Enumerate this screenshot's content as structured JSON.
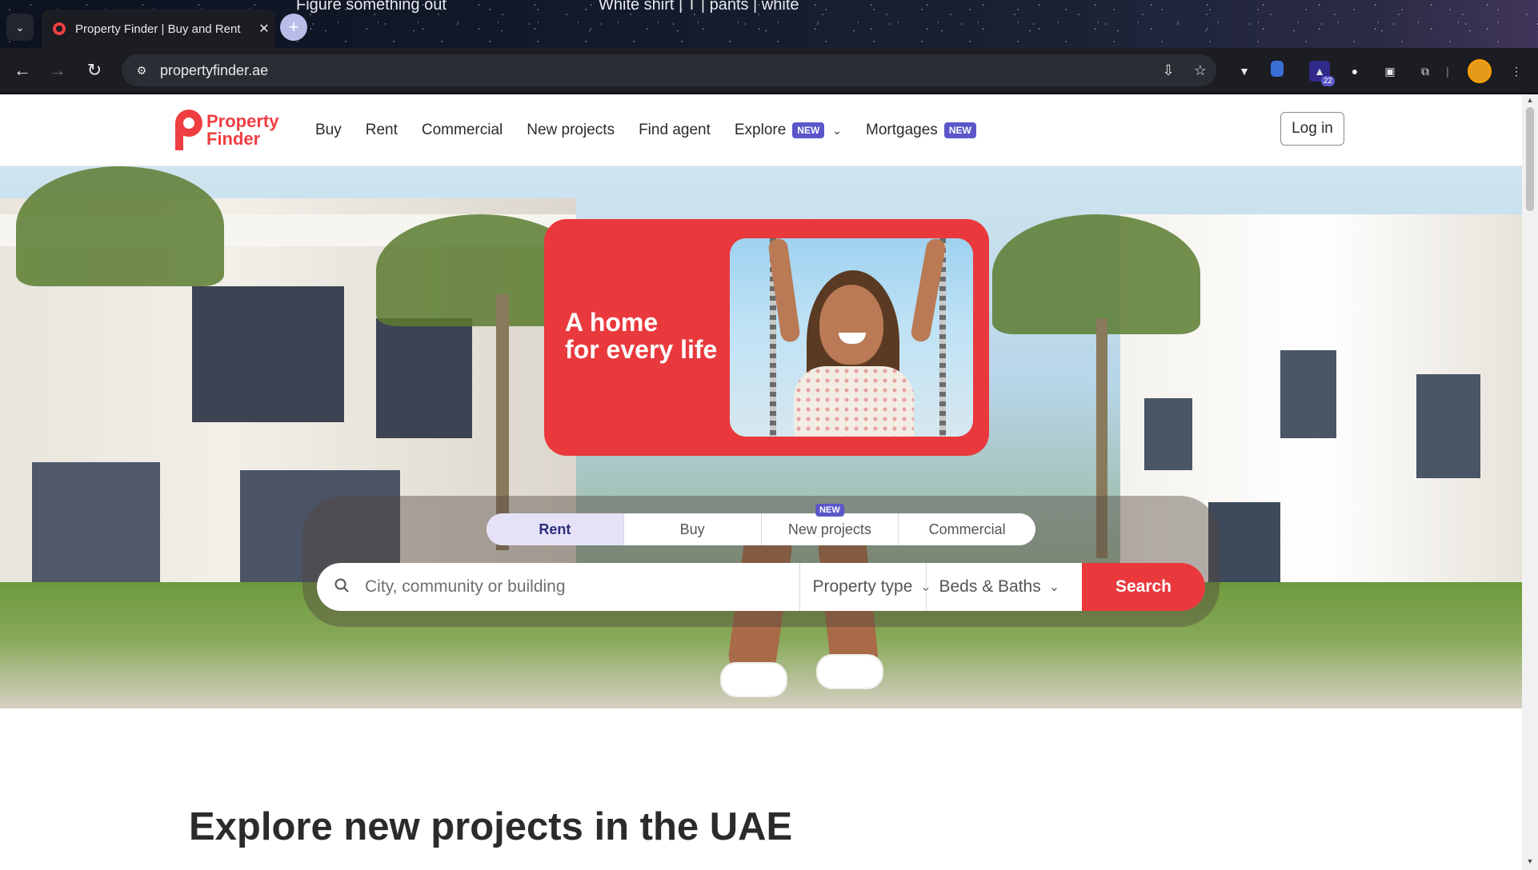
{
  "browser": {
    "active_tab_title": "Property Finder | Buy and Rent",
    "inactive_tabs": [
      "Figure something out",
      "White shirt | T | pants | white"
    ],
    "url": "propertyfinder.ae",
    "extension_badge_count": "22"
  },
  "header": {
    "logo_line1": "Property",
    "logo_line2": "Finder",
    "nav": [
      {
        "label": "Buy"
      },
      {
        "label": "Rent"
      },
      {
        "label": "Commercial"
      },
      {
        "label": "New projects"
      },
      {
        "label": "Find agent"
      },
      {
        "label": "Explore",
        "badge": "NEW"
      },
      {
        "label": "Mortgages",
        "badge": "NEW"
      }
    ],
    "login_label": "Log in"
  },
  "hero": {
    "headline_line1": "A home",
    "headline_line2": "for every life"
  },
  "search": {
    "tabs": [
      {
        "label": "Rent",
        "active": true
      },
      {
        "label": "Buy"
      },
      {
        "label": "New projects",
        "badge": "NEW"
      },
      {
        "label": "Commercial"
      }
    ],
    "placeholder": "City, community or building",
    "property_type": "Property type",
    "beds_baths": "Beds & Baths",
    "button": "Search"
  },
  "section": {
    "title": "Explore new projects in the UAE"
  },
  "colors": {
    "brand_red": "#e9393d",
    "badge_purple": "#5b57c8",
    "active_tab_bg": "#e5e2f7"
  }
}
